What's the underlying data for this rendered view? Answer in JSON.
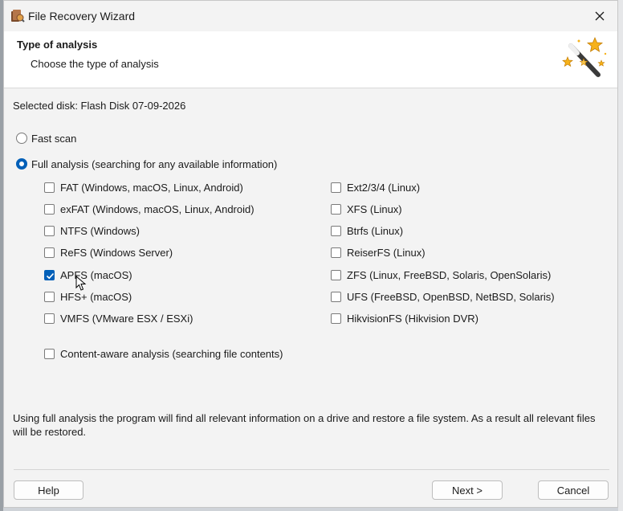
{
  "window": {
    "title": "File Recovery Wizard",
    "close_icon": "close-icon"
  },
  "header": {
    "title": "Type of analysis",
    "subtitle": "Choose the type of analysis",
    "icon": "magic-wand-icon"
  },
  "selected_disk": "Selected disk: Flash Disk 07-09-2026",
  "scan_options": [
    {
      "label": "Fast scan",
      "selected": false
    },
    {
      "label": "Full analysis (searching for any available information)",
      "selected": true
    }
  ],
  "filesystems_left": [
    {
      "label": "FAT (Windows, macOS, Linux, Android)",
      "checked": false
    },
    {
      "label": "exFAT (Windows, macOS, Linux, Android)",
      "checked": false
    },
    {
      "label": "NTFS (Windows)",
      "checked": false
    },
    {
      "label": "ReFS (Windows Server)",
      "checked": false
    },
    {
      "label": "APFS (macOS)",
      "checked": true
    },
    {
      "label": "HFS+ (macOS)",
      "checked": false
    },
    {
      "label": "VMFS (VMware ESX / ESXi)",
      "checked": false
    }
  ],
  "filesystems_right": [
    {
      "label": "Ext2/3/4 (Linux)",
      "checked": false
    },
    {
      "label": "XFS (Linux)",
      "checked": false
    },
    {
      "label": "Btrfs (Linux)",
      "checked": false
    },
    {
      "label": "ReiserFS (Linux)",
      "checked": false
    },
    {
      "label": "ZFS (Linux, FreeBSD, Solaris, OpenSolaris)",
      "checked": false
    },
    {
      "label": "UFS (FreeBSD, OpenBSD, NetBSD, Solaris)",
      "checked": false
    },
    {
      "label": "HikvisionFS (Hikvision DVR)",
      "checked": false
    }
  ],
  "content_aware": {
    "label": "Content-aware analysis (searching file contents)",
    "checked": false
  },
  "description": "Using full analysis the program will find all relevant information on a drive and restore a file system. As a result all relevant files will be restored.",
  "buttons": {
    "help": "Help",
    "next": "Next >",
    "cancel": "Cancel"
  },
  "colors": {
    "accent": "#005fb8",
    "window_bg": "#f3f3f3",
    "header_bg": "#ffffff"
  }
}
